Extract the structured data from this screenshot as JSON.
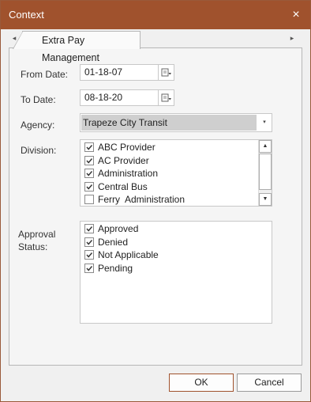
{
  "window": {
    "title": "Context",
    "close_glyph": "×"
  },
  "tabs": {
    "active_label": "Extra Pay Management",
    "scroll_left_glyph": "◂",
    "scroll_right_glyph": "▸"
  },
  "form": {
    "from_date": {
      "label": "From Date:",
      "value": "01-18-07"
    },
    "to_date": {
      "label": "To Date:",
      "value": "08-18-20"
    },
    "agency": {
      "label": "Agency:",
      "value": "Trapeze City Transit",
      "arrow": "▾"
    },
    "division": {
      "label": "Division:",
      "items": [
        {
          "label": "ABC Provider",
          "checked": true
        },
        {
          "label": "AC Provider",
          "checked": true
        },
        {
          "label": "Administration",
          "checked": true
        },
        {
          "label": "Central Bus",
          "checked": true
        },
        {
          "label": "Ferry  Administration",
          "checked": false
        }
      ],
      "scroll_up_glyph": "▲",
      "scroll_down_glyph": "▼"
    },
    "approval_status": {
      "label_line1": "Approval",
      "label_line2": "Status:",
      "items": [
        {
          "label": "Approved",
          "checked": true
        },
        {
          "label": "Denied",
          "checked": true
        },
        {
          "label": "Not Applicable",
          "checked": true
        },
        {
          "label": "Pending",
          "checked": true
        }
      ]
    }
  },
  "buttons": {
    "ok": "OK",
    "cancel": "Cancel"
  },
  "colors": {
    "titlebar": "#a0522d",
    "ok_border": "#a0522d"
  },
  "icons": {
    "date_picker": "calendar-picker-icon",
    "checkmark": "checkmark-icon"
  }
}
